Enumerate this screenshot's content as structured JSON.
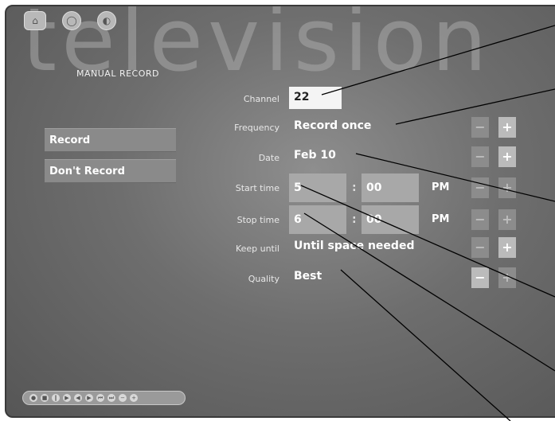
{
  "watermark": "television",
  "titlebar": {
    "icons": [
      "home-icon",
      "back-icon",
      "menu-icon"
    ],
    "glyphs": [
      "⌂",
      "◯",
      "◐"
    ]
  },
  "section_title": "MANUAL RECORD",
  "side_buttons": {
    "record": "Record",
    "dont_record": "Don't Record"
  },
  "fields": {
    "channel": {
      "label": "Channel",
      "value": "22"
    },
    "frequency": {
      "label": "Frequency",
      "value": "Record once"
    },
    "date": {
      "label": "Date",
      "value": "Feb 10"
    },
    "start_time": {
      "label": "Start time",
      "hour": "5",
      "minute": "00",
      "ampm": "PM"
    },
    "stop_time": {
      "label": "Stop time",
      "hour": "6",
      "minute": "00",
      "ampm": "PM"
    },
    "keep_until": {
      "label": "Keep until",
      "value": "Until space needed"
    },
    "quality": {
      "label": "Quality",
      "value": "Best"
    }
  },
  "stepper": {
    "minus": "−",
    "plus": "+"
  },
  "colon": ":",
  "colors": {
    "panel_bg": "#6e6e6e",
    "highlight_box": "#f4f4f4",
    "callout_line": "#000000"
  }
}
